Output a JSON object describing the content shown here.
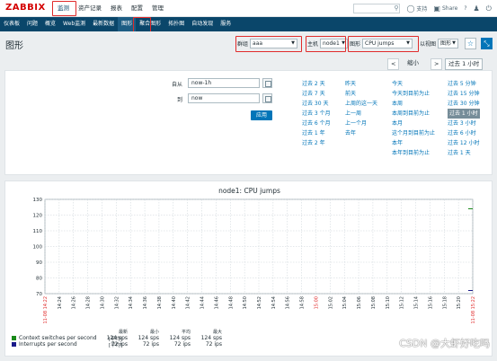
{
  "app": {
    "logo": "ZABBIX"
  },
  "top_nav": [
    {
      "label": "监测",
      "active": true
    },
    {
      "label": "资产记录"
    },
    {
      "label": "报表"
    },
    {
      "label": "配置"
    },
    {
      "label": "管理"
    }
  ],
  "top_right": {
    "support": "支持",
    "share": "Share",
    "help": "?",
    "user_icon": "user-icon",
    "logout_icon": "power-icon"
  },
  "sub_nav": [
    {
      "label": "仪表板"
    },
    {
      "label": "问题"
    },
    {
      "label": "概览"
    },
    {
      "label": "Web监测"
    },
    {
      "label": "最新数据"
    },
    {
      "label": "图形",
      "active": true
    },
    {
      "label": "聚合图形"
    },
    {
      "label": "拓扑图"
    },
    {
      "label": "自动发现"
    },
    {
      "label": "服务"
    }
  ],
  "header": {
    "title": "图形",
    "group_label": "群组",
    "group_value": "aaa",
    "host_label": "主机",
    "host_value": "node1",
    "graph_label": "图形",
    "graph_value": "CPU jumps",
    "view_label": "以视图",
    "view_value": "图形"
  },
  "timenav": {
    "prev": "<",
    "zoom_out": "缩小",
    "next": ">",
    "current": "过去 1 小时"
  },
  "filter": {
    "from_label": "自从",
    "from_value": "now-1h",
    "to_label": "到",
    "to_value": "now",
    "apply": "应用",
    "columns": [
      [
        "过去 2 天",
        "过去 7 天",
        "过去 30 天",
        "过去 3 个月",
        "过去 6 个月",
        "过去 1 年",
        "过去 2 年"
      ],
      [
        "昨天",
        "前天",
        "上周的这一天",
        "上一周",
        "上一个月",
        "去年"
      ],
      [
        "今天",
        "今天到目前为止",
        "本周",
        "本周到目前为止",
        "本月",
        "这个月到目前为止",
        "本年",
        "本年到目前为止"
      ],
      [
        "过去 5 分钟",
        "过去 15 分钟",
        "过去 30 分钟",
        "过去 1 小时",
        "过去 3 小时",
        "过去 6 小时",
        "过去 12 小时",
        "过去 1 天"
      ]
    ]
  },
  "graph": {
    "title": "node1: CPU jumps",
    "legend": [
      {
        "name": "Context switches per second",
        "color": "#1a8a1a",
        "fn": "[平均]",
        "last": "124 sps",
        "min": "124 sps",
        "avg": "124 sps",
        "max": "124 sps"
      },
      {
        "name": "Interrupts per second",
        "color": "#1a1a8a",
        "fn": "[平均]",
        "last": "72 ips",
        "min": "72 ips",
        "avg": "72 ips",
        "max": "72 ips"
      }
    ],
    "col_heads": [
      "最新",
      "最小",
      "平均",
      "最大"
    ],
    "start_label": "11-08 14:22",
    "end_label": "11-08 15:22",
    "mid_label": "15:00"
  },
  "chart_data": {
    "type": "line",
    "title": "node1: CPU jumps",
    "ylim": [
      70,
      130
    ],
    "yticks": [
      70,
      80,
      90,
      100,
      110,
      120,
      130
    ],
    "xticks": [
      "11-08 14:22",
      "14:24",
      "14:26",
      "14:28",
      "14:30",
      "14:32",
      "14:34",
      "14:36",
      "14:38",
      "14:40",
      "14:42",
      "14:44",
      "14:46",
      "14:48",
      "14:50",
      "14:52",
      "14:54",
      "14:56",
      "14:58",
      "15:00",
      "15:02",
      "15:04",
      "15:06",
      "15:08",
      "15:10",
      "15:12",
      "15:14",
      "15:16",
      "15:18",
      "15:20",
      "11-08 15:22"
    ],
    "grid": true,
    "series": [
      {
        "name": "Context switches per second",
        "color": "#1a8a1a",
        "x": [
          "15:22"
        ],
        "values": [
          124
        ]
      },
      {
        "name": "Interrupts per second",
        "color": "#1a1a8a",
        "x": [
          "15:22"
        ],
        "values": [
          72
        ]
      }
    ]
  },
  "watermark": "CSDN @大虾好吃吗"
}
